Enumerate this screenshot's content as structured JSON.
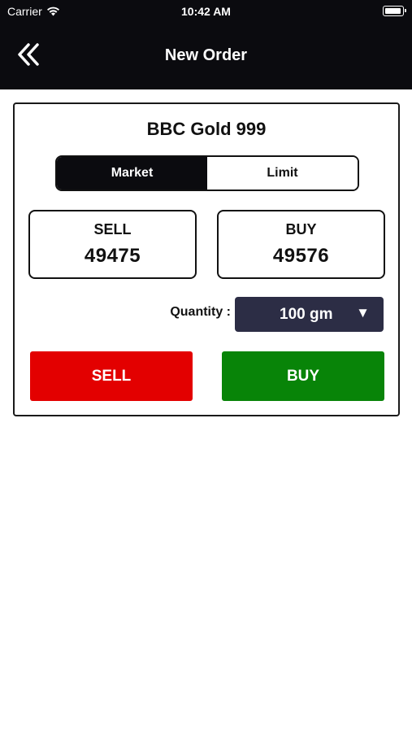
{
  "status_bar": {
    "carrier": "Carrier",
    "time": "10:42 AM"
  },
  "nav": {
    "title": "New Order",
    "back_icon": "double-chevron-left-icon"
  },
  "instrument": {
    "name": "BBC Gold 999"
  },
  "order_type": {
    "options": [
      "Market",
      "Limit"
    ],
    "selected": "Market"
  },
  "prices": {
    "sell": {
      "label": "SELL",
      "value": "49475"
    },
    "buy": {
      "label": "BUY",
      "value": "49576"
    }
  },
  "quantity": {
    "label": "Quantity :",
    "value": "100 gm",
    "arrow": "▼"
  },
  "actions": {
    "sell_label": "SELL",
    "buy_label": "BUY"
  },
  "colors": {
    "header_bg": "#0b0b0f",
    "sell": "#e30000",
    "buy": "#088408",
    "dropdown_bg": "#2c2d45"
  }
}
